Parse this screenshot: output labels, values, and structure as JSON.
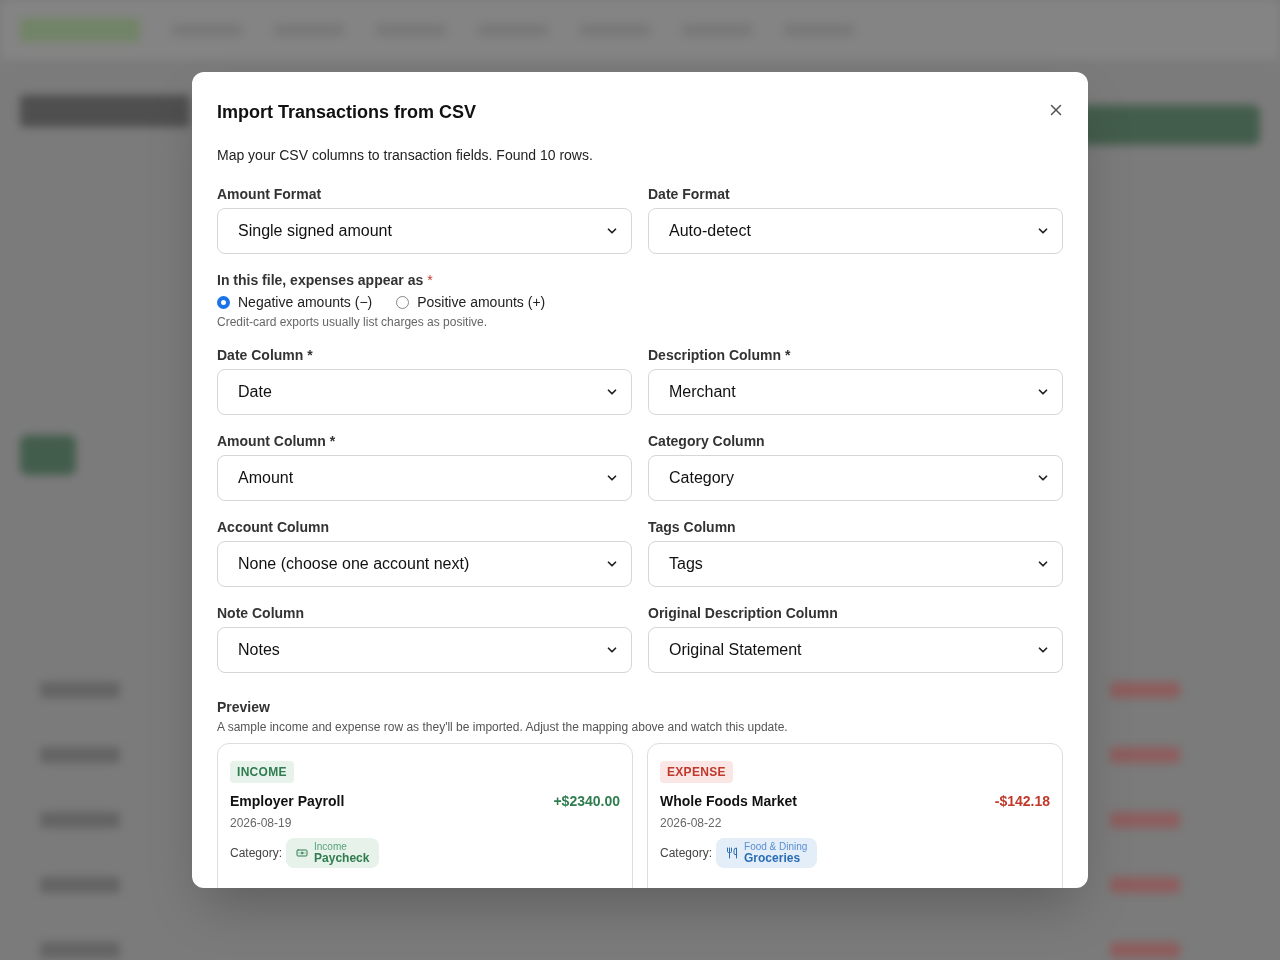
{
  "dialog": {
    "title": "Import Transactions from CSV",
    "description": "Map your CSV columns to transaction fields. Found 10 rows.",
    "format_fields": [
      {
        "label": "Amount Format",
        "value": "Single signed amount"
      },
      {
        "label": "Date Format",
        "value": "Auto-detect"
      }
    ],
    "sign_question": {
      "label": "In this file, expenses appear as",
      "required_mark": "*",
      "options": [
        {
          "label": "Negative amounts (−)",
          "selected": true
        },
        {
          "label": "Positive amounts (+)",
          "selected": false
        }
      ],
      "hint": "Credit-card exports usually list charges as positive."
    },
    "column_fields": [
      {
        "label": "Date Column *",
        "value": "Date"
      },
      {
        "label": "Description Column *",
        "value": "Merchant"
      },
      {
        "label": "Amount Column *",
        "value": "Amount"
      },
      {
        "label": "Category Column",
        "value": "Category"
      },
      {
        "label": "Account Column",
        "value": "None (choose one account next)"
      },
      {
        "label": "Tags Column",
        "value": "Tags"
      },
      {
        "label": "Note Column",
        "value": "Notes"
      },
      {
        "label": "Original Description Column",
        "value": "Original Statement"
      }
    ],
    "preview": {
      "title": "Preview",
      "description": "A sample income and expense row as they'll be imported. Adjust the mapping above and watch this update.",
      "cards": [
        {
          "kind": "income",
          "badge": "INCOME",
          "name": "Employer Payroll",
          "amount": "+$2340.00",
          "date": "2026-08-19",
          "category_label": "Category:",
          "category_group": "Income",
          "category": "Paycheck"
        },
        {
          "kind": "expense",
          "badge": "EXPENSE",
          "name": "Whole Foods Market",
          "amount": "-$142.18",
          "date": "2026-08-22",
          "category_label": "Category:",
          "category_group": "Food & Dining",
          "category": "Groceries"
        }
      ]
    }
  }
}
